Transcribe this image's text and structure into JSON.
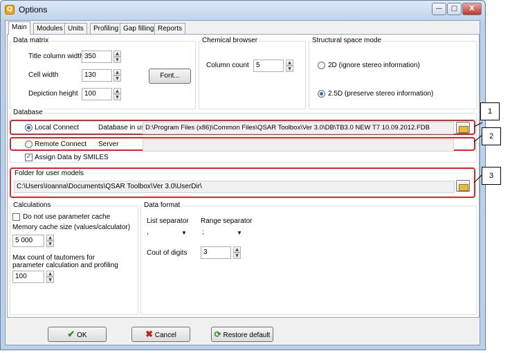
{
  "window": {
    "title": "Options",
    "app_icon": "Q",
    "minimize": "—",
    "maximize": "□",
    "close": "X"
  },
  "tabs": [
    "Main",
    "Modules",
    "Units",
    "Profiling",
    "Gap filling",
    "Reports"
  ],
  "data_matrix": {
    "title": "Data matrix",
    "title_col_label": "Title column width",
    "title_col_value": "350",
    "cell_width_label": "Cell width",
    "cell_width_value": "130",
    "depiction_label": "Depiction height",
    "depiction_value": "100",
    "font_button": "Font..."
  },
  "chemical_browser": {
    "title": "Chemical browser",
    "column_count_label": "Column count",
    "column_count_value": "5"
  },
  "structural_space": {
    "title": "Structural space mode",
    "option_2d": "2D  (ignore stereo information)",
    "option_25d": "2.5D (preserve stereo information)"
  },
  "database": {
    "title": "Database",
    "local_connect": "Local Connect",
    "db_in_use_label": "Database in use",
    "db_path": "D:\\Program Files (x86)\\Common Files\\QSAR Toolbox\\Ver 3.0\\DB\\TB3.0 NEW T7 10.09.2012.FDB",
    "remote_connect": "Remote Connect",
    "server_label": "Server",
    "assign_smiles": "Assign Data by SMILES"
  },
  "user_models": {
    "title": "Folder for user models",
    "path": "C:\\Users\\Ioanna\\Documents\\QSAR Toolbox\\Ver 3.0\\UserDir\\"
  },
  "calculations": {
    "title": "Calculations",
    "no_cache": "Do not use parameter cache",
    "mem_label": "Memory cache size (values/calculator)",
    "mem_value": "5 000",
    "taut_label_1": "Max count of tautomers for",
    "taut_label_2": "parameter calculation and profiling",
    "taut_value": "100"
  },
  "data_format": {
    "title": "Data format",
    "list_sep_label": "List separator",
    "list_sep_value": ",",
    "range_sep_label": "Range separator",
    "range_sep_value": ";",
    "digits_label": "Cout of digits",
    "digits_value": "3"
  },
  "buttons": {
    "ok": "OK",
    "cancel": "Cancel",
    "restore": "Restore default"
  },
  "callouts": [
    "1",
    "2",
    "3"
  ]
}
